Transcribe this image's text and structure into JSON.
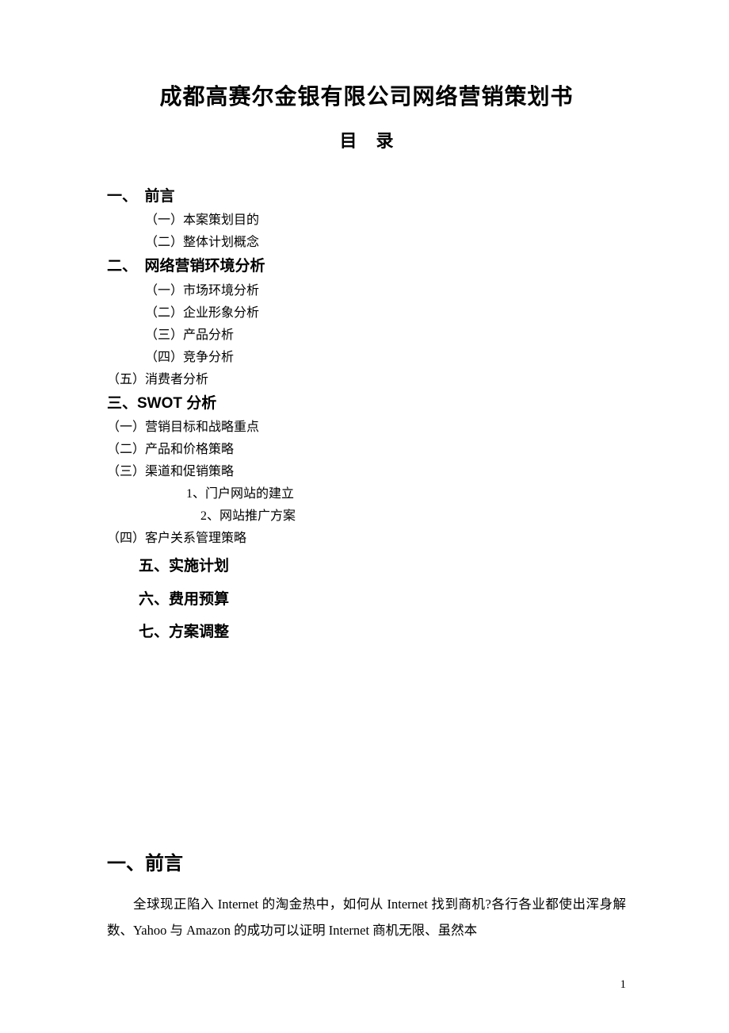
{
  "title": "成都高赛尔金银有限公司网络营销策划书",
  "subtitle": "目录",
  "toc": {
    "s1": "一、　前言",
    "s1_1": "（一）本案策划目的",
    "s1_2": "（二）整体计划概念",
    "s2": "二、　网络营销环境分析",
    "s2_1": "（一）市场环境分析",
    "s2_2": "（二）企业形象分析",
    "s2_3": "（三）产品分析",
    "s2_4": "（四）竞争分析",
    "s2_5": "（五）消费者分析",
    "s3": "三、SWOT 分析",
    "s3_1": "（一）营销目标和战略重点",
    "s3_2": "（二）产品和价格策略",
    "s3_3": "（三）渠道和促销策略",
    "s3_3_1": "1、门户网站的建立",
    "s3_3_2": "2、网站推广方案",
    "s3_4": "（四）客户关系管理策略",
    "s5": "五、实施计划",
    "s6": "六、费用预算",
    "s7": "七、方案调整"
  },
  "section1": {
    "heading": "一、前言",
    "para": "全球现正陷入 Internet 的淘金热中，如何从 Internet 找到商机?各行各业都使出浑身解数、Yahoo 与 Amazon 的成功可以证明 Internet 商机无限、虽然本"
  },
  "pageNumber": "1"
}
